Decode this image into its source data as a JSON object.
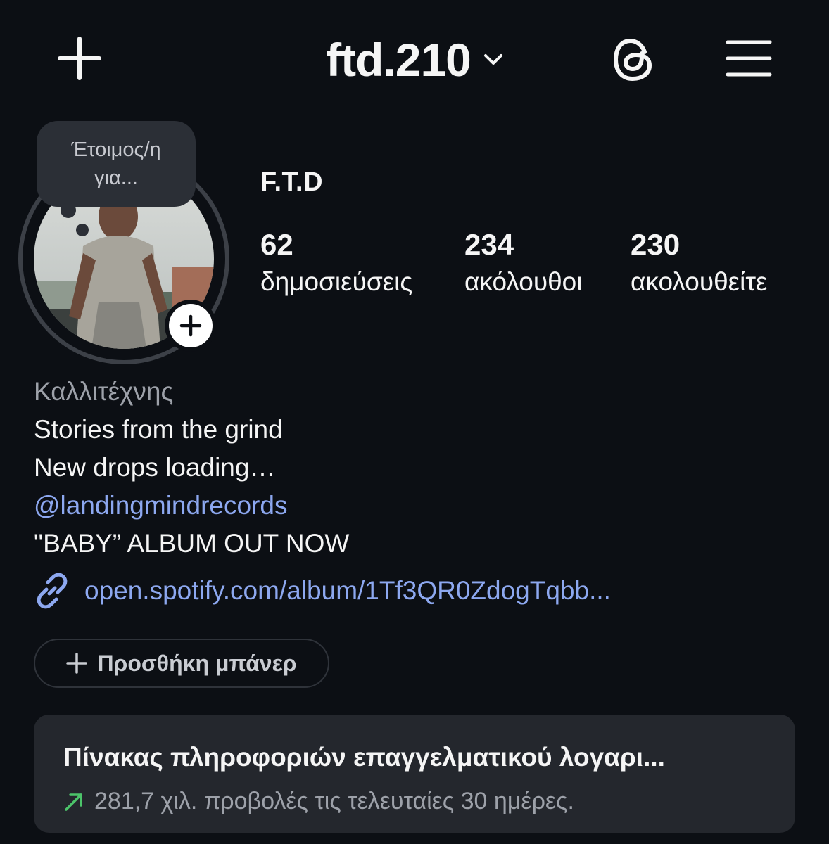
{
  "header": {
    "username": "ftd.210",
    "icons": {
      "new_post": "plus-icon",
      "switch_account": "chevron-down-icon",
      "threads": "threads-icon",
      "menu": "hamburger-menu-icon"
    }
  },
  "profile": {
    "note": "Έτοιμος/η για...",
    "display_name": "F.T.D",
    "stats": {
      "posts": {
        "count": "62",
        "label": "δημοσιεύσεις"
      },
      "followers": {
        "count": "234",
        "label": "ακόλουθοι"
      },
      "following": {
        "count": "230",
        "label": "ακολουθείτε"
      }
    }
  },
  "bio": {
    "category": "Καλλιτέχνης",
    "line1": "Stories from the grind",
    "line2": "New drops loading…",
    "mention": "@landingmindrecords",
    "line4": "\"BABY” ALBUM OUT NOW",
    "link": "open.spotify.com/album/1Tf3QR0ZdogTqbb..."
  },
  "banner": {
    "label": "Προσθήκη μπάνερ"
  },
  "dashboard": {
    "title": "Πίνακας πληροφοριών επαγγελματικού λογαρι...",
    "stat": "281,7 χιλ. προβολές τις τελευταίες 30 ημέρες."
  },
  "colors": {
    "background": "#0c0f14",
    "link": "#8da8f0",
    "trend_up": "#4cc46a",
    "card": "#24272d"
  }
}
